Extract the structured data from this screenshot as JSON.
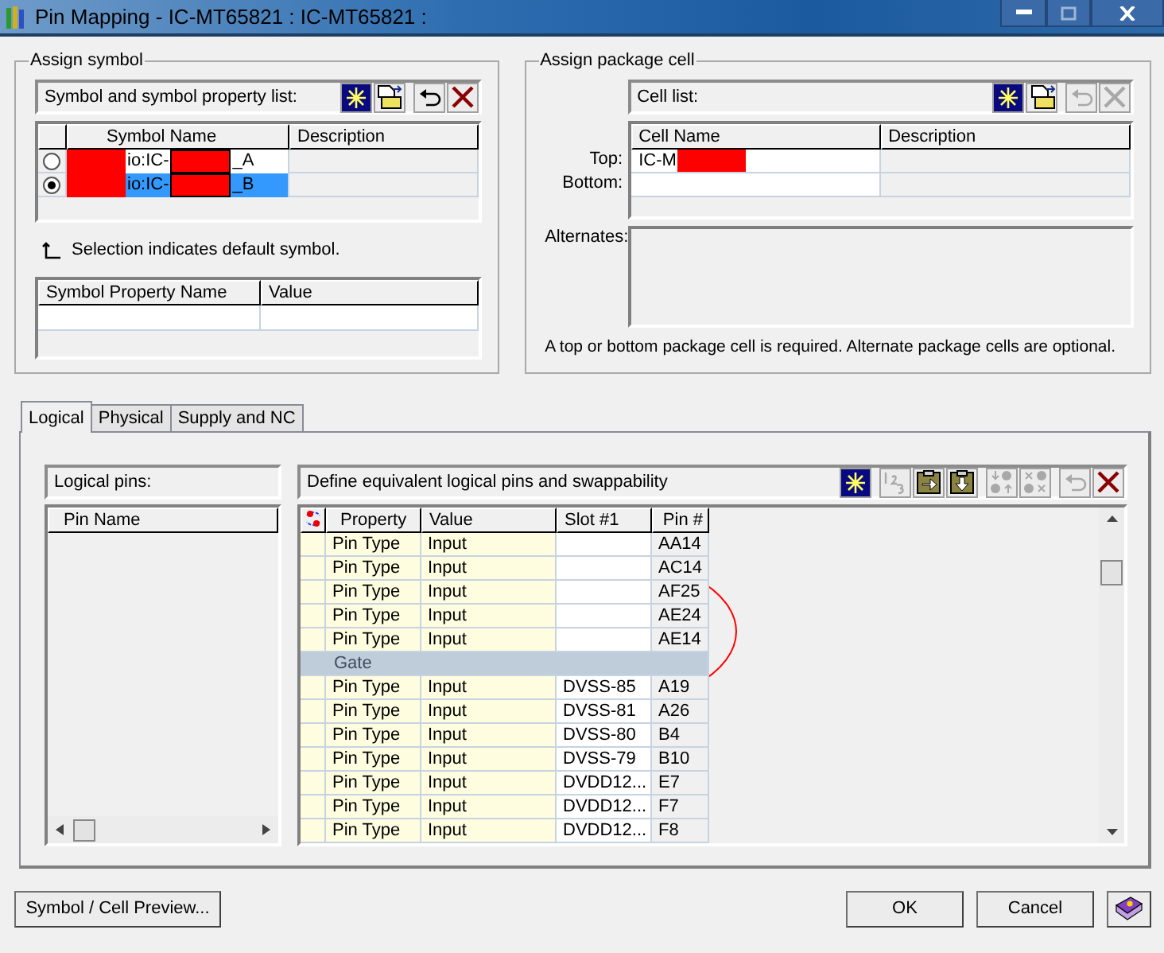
{
  "window": {
    "title": "Pin Mapping - IC-MT65821 : IC-MT65821 :"
  },
  "assign_symbol": {
    "title": "Assign symbol",
    "list_label": "Symbol and symbol property list:",
    "tools": [
      {
        "kind": "new",
        "disabled": false
      },
      {
        "kind": "import",
        "disabled": false
      },
      {
        "kind": "undo",
        "disabled": false
      },
      {
        "kind": "delete",
        "disabled": false
      }
    ],
    "columns": [
      "Symbol Name",
      "Description"
    ],
    "rows": [
      {
        "name_start": "io:IC-",
        "name_end": "_A",
        "selected": false
      },
      {
        "name_start": "io:IC-",
        "name_end": "_B",
        "selected": true
      }
    ],
    "hint": "Selection indicates default symbol.",
    "property_columns": [
      "Symbol Property Name",
      "Value"
    ]
  },
  "assign_package_cell": {
    "title": "Assign package cell",
    "list_label": "Cell list:",
    "tools": [
      {
        "kind": "new",
        "disabled": false
      },
      {
        "kind": "import",
        "disabled": false
      },
      {
        "kind": "undo",
        "disabled": true
      },
      {
        "kind": "delete",
        "disabled": true
      }
    ],
    "columns": [
      "Cell Name",
      "Description"
    ],
    "rows": [
      {
        "label": "Top:",
        "cell_name": "IC-M"
      },
      {
        "label": "Bottom:"
      }
    ],
    "alternates_label": "Alternates:",
    "note": "A top or bottom package cell is required.  Alternate package cells are optional."
  },
  "tabs": [
    {
      "label": "Logical",
      "selected": true
    },
    {
      "label": "Physical",
      "selected": false
    },
    {
      "label": "Supply and NC",
      "selected": false
    }
  ],
  "logical_pins": {
    "label": "Logical pins:",
    "column": "Pin Name"
  },
  "equivalence": {
    "label": "Define equivalent logical pins and swappability",
    "tools": [
      {
        "kind": "new",
        "disabled": false
      },
      {
        "kind": "number",
        "disabled": true
      },
      {
        "kind": "paste-right",
        "disabled": false
      },
      {
        "kind": "paste-down",
        "disabled": false
      },
      {
        "kind": "swap",
        "disabled": true
      },
      {
        "kind": "clear",
        "disabled": true
      },
      {
        "kind": "undo",
        "disabled": true
      },
      {
        "kind": "delete",
        "disabled": false
      }
    ],
    "columns": [
      "Property",
      "Value",
      "Slot #1",
      "Pin #"
    ],
    "rows": [
      {
        "kind": "pin",
        "property": "Pin Type",
        "value": "Input",
        "pin": "AA14"
      },
      {
        "kind": "pin",
        "property": "Pin Type",
        "value": "Input",
        "pin": "AC14"
      },
      {
        "kind": "pin",
        "property": "Pin Type",
        "value": "Input",
        "pin": "AF25"
      },
      {
        "kind": "pin",
        "property": "Pin Type",
        "value": "Input",
        "pin": "AE24"
      },
      {
        "kind": "pin",
        "property": "Pin Type",
        "value": "Input",
        "pin": "AE14"
      },
      {
        "kind": "group",
        "label": "Gate"
      },
      {
        "kind": "pin",
        "property": "Pin Type",
        "value": "Input",
        "slot": "DVSS-85",
        "pin": "A19"
      },
      {
        "kind": "pin",
        "property": "Pin Type",
        "value": "Input",
        "slot": "DVSS-81",
        "pin": "A26"
      },
      {
        "kind": "pin",
        "property": "Pin Type",
        "value": "Input",
        "slot": "DVSS-80",
        "pin": "B4"
      },
      {
        "kind": "pin",
        "property": "Pin Type",
        "value": "Input",
        "slot": "DVSS-79",
        "pin": "B10"
      },
      {
        "kind": "pin",
        "property": "Pin Type",
        "value": "Input",
        "slot": "DVDD12...",
        "pin": "E7"
      },
      {
        "kind": "pin",
        "property": "Pin Type",
        "value": "Input",
        "slot": "DVDD12...",
        "pin": "F7"
      },
      {
        "kind": "pin",
        "property": "Pin Type",
        "value": "Input",
        "slot": "DVDD12...",
        "pin": "F8"
      }
    ]
  },
  "buttons": {
    "preview": "Symbol / Cell Preview...",
    "ok": "OK",
    "cancel": "Cancel"
  }
}
